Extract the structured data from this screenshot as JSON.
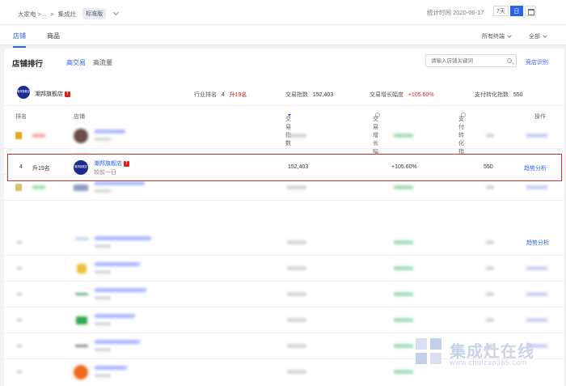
{
  "topbar": {
    "breadcrumb": [
      "大家电 >...",
      ">",
      "集成灶"
    ],
    "chip": "标准版",
    "stat_time": "统计时间 2020-06-17",
    "periods": [
      "7天",
      "日"
    ],
    "active_period": "日"
  },
  "tabs": {
    "items": [
      "店铺",
      "商品"
    ],
    "active": "店铺"
  },
  "filters": {
    "terminal": "所有终端",
    "scope": "全部"
  },
  "panel": {
    "title": "店铺排行",
    "subtabs": [
      "高交易",
      "高流量"
    ],
    "active_subtab": "高交易",
    "search_placeholder": "请输入店铺关键词",
    "compete_link": "竞店识别"
  },
  "summary": {
    "logo_text": "潮邦旗舰店",
    "shop_name": "潮邦旗舰店",
    "rank_label": "行业排名",
    "rank_value": "4",
    "rank_change": "升19名",
    "trade_label": "交易指数",
    "trade_value": "152,403",
    "growth_label": "交易增长幅度",
    "growth_value": "+105.60%",
    "conv_label": "支付转化指数",
    "conv_value": "550"
  },
  "table": {
    "headers": [
      "排名",
      "店铺",
      "交易指数",
      "交易增长幅度",
      "支付转化指数",
      "操作"
    ],
    "highlight_row": {
      "rank": "4",
      "rank_change": "升19名",
      "logo_text": "潮邦旗舰店",
      "shop_name": "潮邦旗舰店",
      "sub": "较前一日",
      "trade": "152,403",
      "growth": "+105.60%",
      "conv": "550",
      "action": "趋势分析"
    },
    "row_after_action": "趋势分析"
  },
  "watermark": {
    "text": "集成灶在线",
    "url": "www.chuizao365.com"
  },
  "colors": {
    "accent": "#2a63f6",
    "up": "#e0201f",
    "highlight_border": "#d52b2b"
  }
}
